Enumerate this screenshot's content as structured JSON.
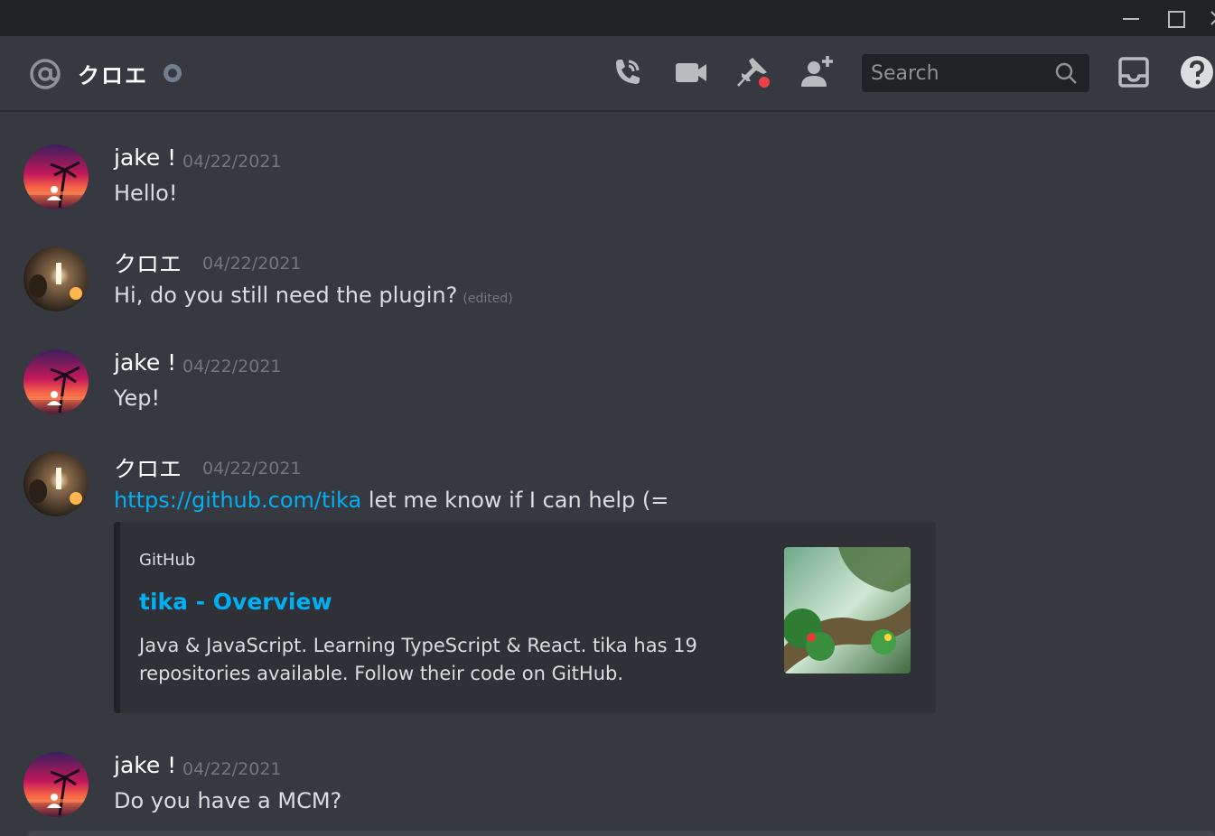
{
  "window": {
    "minimize_label": "minimize",
    "maximize_label": "maximize",
    "close_label": "close"
  },
  "header": {
    "channel_name": "クロエ",
    "search": {
      "placeholder": "Search"
    }
  },
  "colors": {
    "background": "#36393f",
    "titlebar": "#202225",
    "link": "#00aff4",
    "muted": "#72767d",
    "status_offline": "#747f8d",
    "pin_badge": "#ed4245"
  },
  "icons": [
    "at-icon",
    "call-icon",
    "video-icon",
    "pin-icon",
    "add-user-icon",
    "search-icon",
    "inbox-icon",
    "help-icon"
  ],
  "messages": [
    {
      "author": "jake !",
      "timestamp": "04/22/2021",
      "text": "Hello!"
    },
    {
      "author": "クロエ",
      "timestamp": "04/22/2021",
      "text": "Hi, do you still need the plugin?",
      "edited": "(edited)"
    },
    {
      "author": "jake !",
      "timestamp": "04/22/2021",
      "text": "Yep!"
    },
    {
      "author": "クロエ",
      "timestamp": "04/22/2021",
      "link": "https://github.com/tika",
      "text": " let me know if I can help (=",
      "embed": {
        "provider": "GitHub",
        "title": "tika - Overview",
        "description": "Java & JavaScript. Learning TypeScript & React. tika has 19 repositories available. Follow their code on GitHub."
      }
    },
    {
      "author": "jake !",
      "timestamp": "04/22/2021",
      "text": "Do you have a MCM?"
    }
  ]
}
